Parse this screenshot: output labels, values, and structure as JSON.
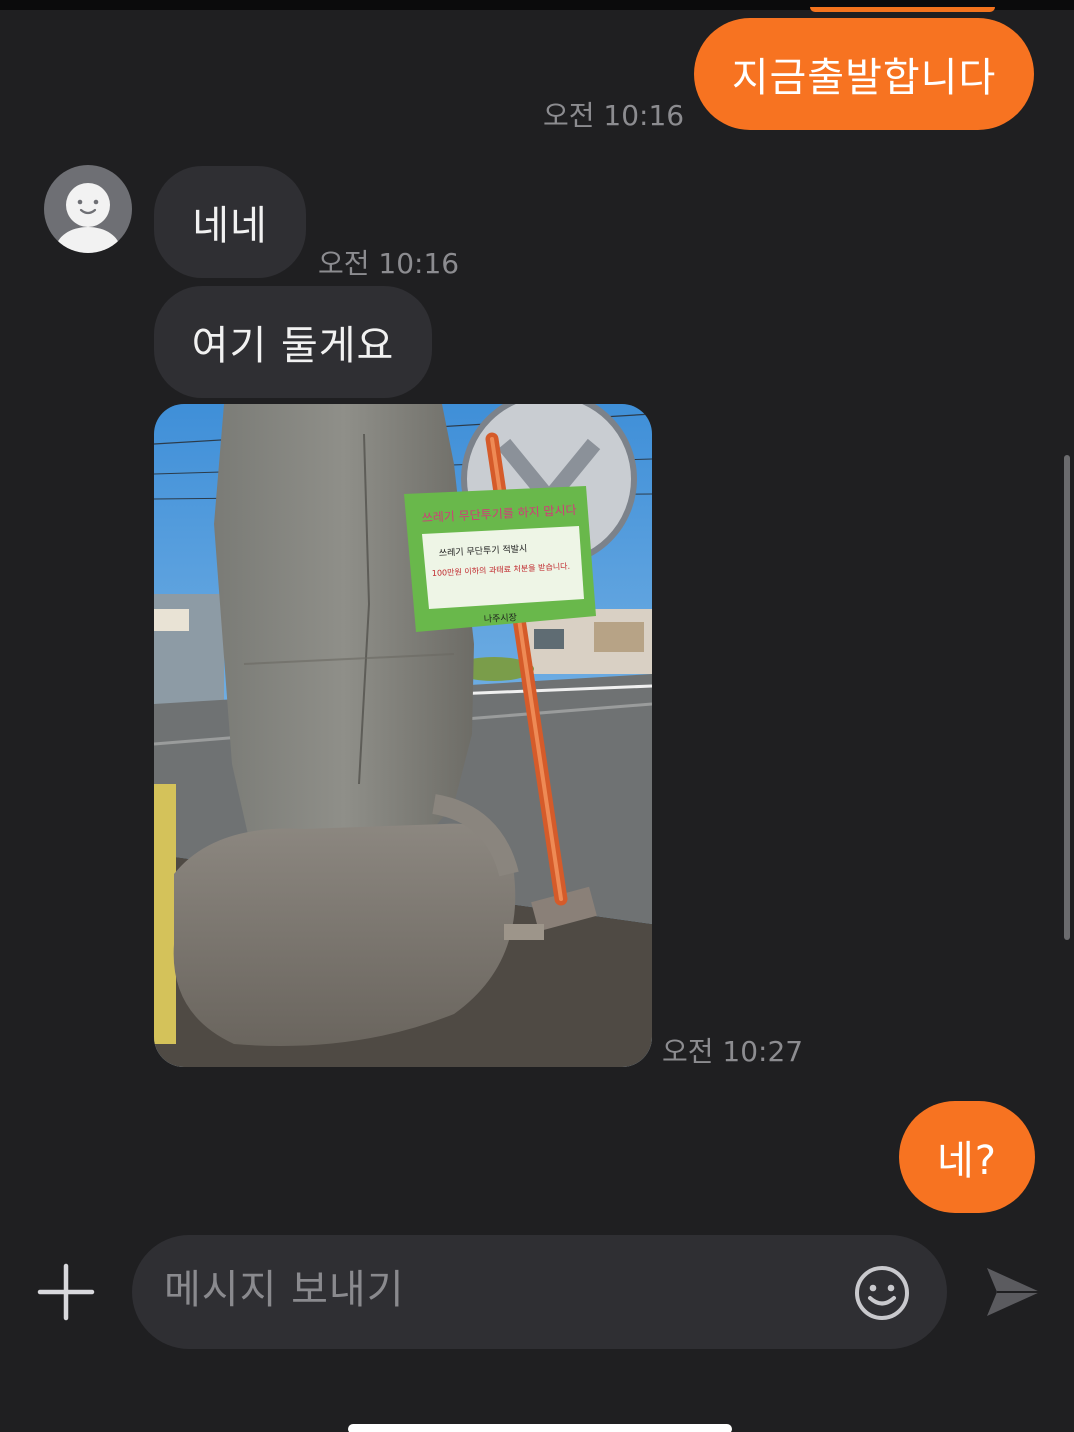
{
  "chat": {
    "messages": [
      {
        "id": "m1",
        "side": "outgoing",
        "type": "text",
        "text": "지금출발합니다",
        "time": "오전 10:16"
      },
      {
        "id": "m2",
        "side": "incoming",
        "type": "text",
        "text": "네네",
        "time": "오전 10:16"
      },
      {
        "id": "m3",
        "side": "incoming",
        "type": "text",
        "text": "여기 둘게요"
      },
      {
        "id": "m4",
        "side": "incoming",
        "type": "image",
        "time": "오전 10:27",
        "image": {
          "sign_line1": "쓰레기 무단투기 적발시",
          "sign_line2": "100만원 이하의 과태료 처분을 받습니다.",
          "sign_footer": "나주시장"
        }
      },
      {
        "id": "m5",
        "side": "outgoing",
        "type": "text",
        "text": "네?"
      }
    ]
  },
  "composer": {
    "placeholder": "메시지 보내기",
    "add_icon": "plus-icon",
    "emoji_icon": "smiley-icon",
    "send_icon": "paper-plane-icon"
  },
  "colors": {
    "background": "#1f1f21",
    "outgoing_bubble": "#f77321",
    "incoming_bubble": "#2f2f33",
    "timestamp": "#8c8c90"
  }
}
